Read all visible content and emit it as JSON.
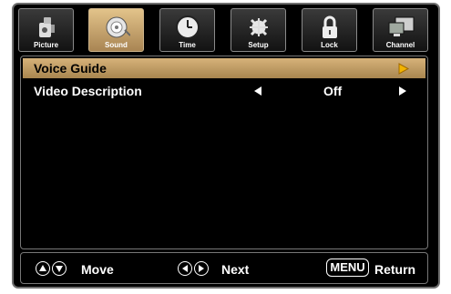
{
  "tabs": [
    {
      "label": "Picture",
      "icon": "picture-icon",
      "active": false
    },
    {
      "label": "Sound",
      "icon": "sound-icon",
      "active": true
    },
    {
      "label": "Time",
      "icon": "clock-icon",
      "active": false
    },
    {
      "label": "Setup",
      "icon": "setup-icon",
      "active": false
    },
    {
      "label": "Lock",
      "icon": "lock-icon",
      "active": false
    },
    {
      "label": "Channel",
      "icon": "channel-icon",
      "active": false
    }
  ],
  "menu": {
    "items": [
      {
        "label": "Voice Guide",
        "value": "",
        "selected": true
      },
      {
        "label": "Video Description",
        "value": "Off",
        "selected": false
      }
    ]
  },
  "footer": {
    "move_label": "Move",
    "next_label": "Next",
    "menu_key": "MENU",
    "return_label": "Return"
  },
  "colors": {
    "background": "#000000",
    "selected_row": "#c9a266",
    "active_tab": "#d4b47e",
    "arrow_highlight": "#f2b300"
  }
}
